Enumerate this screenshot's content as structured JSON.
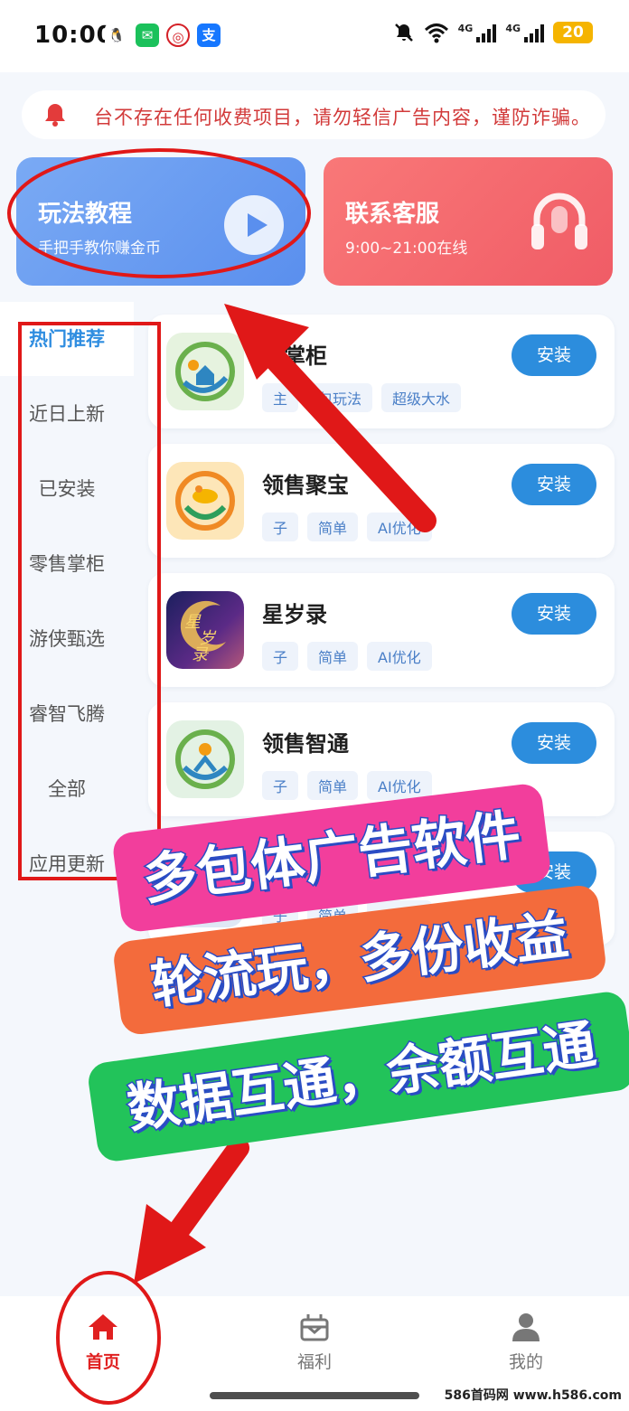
{
  "status_bar": {
    "time": "10:00",
    "apps": [
      {
        "icon": "qq-icon",
        "glyph": "🐧",
        "color": "#111111"
      },
      {
        "icon": "wechat-icon",
        "glyph": "✉",
        "color": "#1bc15b"
      },
      {
        "icon": "bank-icon",
        "glyph": "◎",
        "color": "#d42027"
      },
      {
        "icon": "alipay-icon",
        "glyph": "支",
        "color": "#1677ff"
      }
    ],
    "signal_label_1": "4G",
    "signal_label_2": "4G",
    "battery": "20"
  },
  "notice": {
    "text": "台不存在任何收费项目，请勿轻信广告内容，谨防诈骗。"
  },
  "cards": {
    "tutorial": {
      "title": "玩法教程",
      "subtitle": "手把手教你赚金币"
    },
    "service": {
      "title": "联系客服",
      "subtitle": "9:00~21:00在线"
    }
  },
  "sidenav": {
    "items": [
      "热门推荐",
      "近日上新",
      "已安装",
      "零售掌柜",
      "游侠甄选",
      "睿智飞腾",
      "全部",
      "应用更新"
    ],
    "active_index": 0
  },
  "apps": [
    {
      "name": "售掌柜",
      "tags": [
        "主",
        "包玩法",
        "超级大水"
      ],
      "action": "安装"
    },
    {
      "name": "领售聚宝",
      "tags": [
        "子",
        "简单",
        "AI优化"
      ],
      "action": "安装"
    },
    {
      "name": "星岁录",
      "tags": [
        "子",
        "简单",
        "AI优化"
      ],
      "action": "安装"
    },
    {
      "name": "领售智通",
      "tags": [
        "子",
        "简单",
        "AI优化"
      ],
      "action": "安装"
    },
    {
      "name": "",
      "tags": [
        "子",
        "简单",
        "AI优化"
      ],
      "action": "安装"
    }
  ],
  "app_icon_glyphs": {
    "xingsuilu": "星\n岁\n录"
  },
  "promo": {
    "line1": "多包体广告软件",
    "line2": "轮流玩，多份收益",
    "line3": "数据互通，余额互通"
  },
  "bottom_nav": {
    "home": "首页",
    "welfare": "福利",
    "mine": "我的"
  },
  "watermark": "586首码网 www.h586.com",
  "colors": {
    "accent_blue": "#2c8ddd",
    "notice_red": "#d23a3a",
    "annotation_red": "#e01818"
  }
}
